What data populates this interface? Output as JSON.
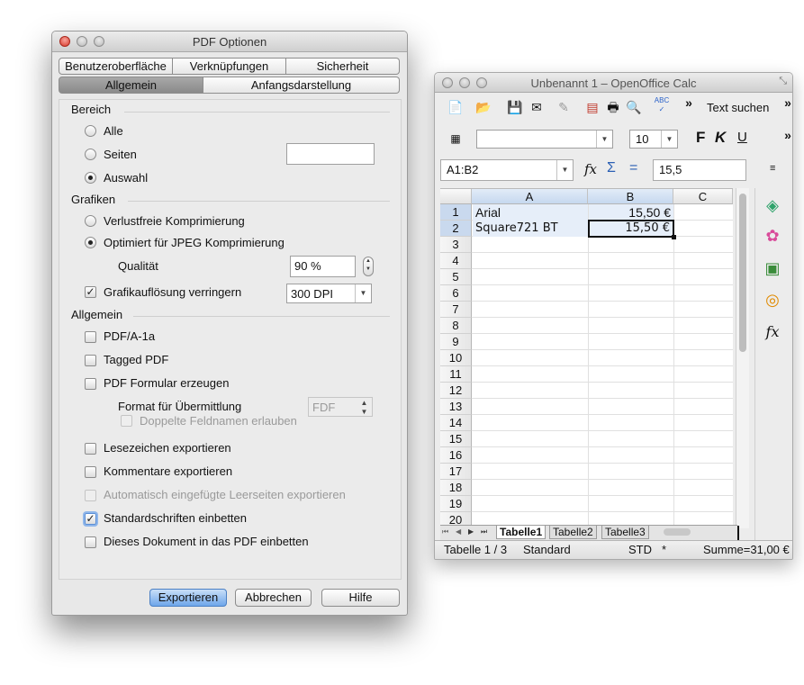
{
  "pdf_dialog": {
    "title": "PDF Optionen",
    "tabs_top": [
      "Benutzeroberfläche",
      "Verknüpfungen",
      "Sicherheit"
    ],
    "tabs_bottom": [
      "Allgemein",
      "Anfangsdarstellung"
    ],
    "active_tab": "Allgemein",
    "bereich": {
      "heading": "Bereich",
      "options": [
        "Alle",
        "Seiten",
        "Auswahl"
      ],
      "selected": "Auswahl",
      "seiten_value": ""
    },
    "grafiken": {
      "heading": "Grafiken",
      "options": [
        "Verlustfreie Komprimierung",
        "Optimiert für JPEG Komprimierung"
      ],
      "selected": "Optimiert für JPEG Komprimierung",
      "quality_label": "Qualität",
      "quality_value": "90 %",
      "reduce_label": "Grafikauflösung verringern",
      "reduce_checked": true,
      "dpi_value": "300 DPI"
    },
    "allgemein": {
      "heading": "Allgemein",
      "pdfa": "PDF/A-1a",
      "tagged": "Tagged PDF",
      "form": "PDF Formular erzeugen",
      "format_label": "Format für Übermittlung",
      "format_value": "FDF",
      "duplicate": "Doppelte Feldnamen erlauben",
      "bookmarks": "Lesezeichen exportieren",
      "comments": "Kommentare exportieren",
      "blank_pages": "Automatisch eingefügte Leerseiten exportieren",
      "embed_fonts": "Standardschriften einbetten",
      "embed_doc": "Dieses Dokument in das PDF einbetten"
    },
    "buttons": {
      "export": "Exportieren",
      "cancel": "Abbrechen",
      "help": "Hilfe"
    }
  },
  "calc": {
    "title": "Unbenannt 1 – OpenOffice Calc",
    "find_text": "Text suchen",
    "font_size": "10",
    "font_name": "",
    "name_box": "A1:B2",
    "formula_value": "15,5",
    "columns": [
      "A",
      "B",
      "C"
    ],
    "rows": [
      "1",
      "2",
      "3",
      "4",
      "5",
      "6",
      "7",
      "8",
      "9",
      "10",
      "11",
      "12",
      "13",
      "14",
      "15",
      "16",
      "17",
      "18",
      "19",
      "20"
    ],
    "cells": {
      "A1": "Arial",
      "B1": "15,50 €",
      "A2": "Square721 BT",
      "B2": "15,50 €"
    },
    "sheet_tabs": [
      "Tabelle1",
      "Tabelle2",
      "Tabelle3"
    ],
    "active_sheet": "Tabelle1",
    "status": {
      "sheet": "Tabelle 1 / 3",
      "style": "Standard",
      "mode": "STD",
      "modified": "*",
      "sum": "Summe=31,00 €"
    },
    "toolbar_labels": {
      "bold": "F",
      "italic": "K",
      "underline": "U",
      "abc": "ABC",
      "more": "»",
      "equals": "=",
      "sigma": "Σ",
      "fx": "fx"
    }
  }
}
